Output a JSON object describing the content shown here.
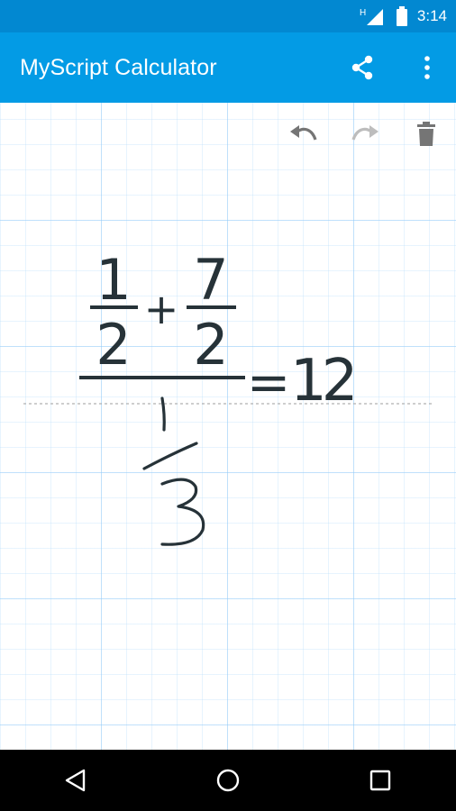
{
  "status_bar": {
    "network_label": "H",
    "time": "3:14"
  },
  "app_bar": {
    "title": "MyScript Calculator",
    "actions": [
      {
        "name": "share",
        "icon": "share-icon"
      },
      {
        "name": "more",
        "icon": "more-vert-icon"
      }
    ]
  },
  "toolbar": {
    "undo_icon": "undo-icon",
    "redo_icon": "redo-icon",
    "delete_icon": "trash-icon"
  },
  "expression": {
    "numerator_left": {
      "top": "1",
      "bottom": "2"
    },
    "operator": "+",
    "numerator_right": {
      "top": "7",
      "bottom": "2"
    },
    "denominator_handwritten": {
      "top": "1",
      "bottom": "3"
    },
    "equals": "=",
    "result": "12"
  },
  "navigation": {
    "back_icon": "back-triangle-icon",
    "home_icon": "home-circle-icon",
    "recents_icon": "recents-square-icon"
  },
  "colors": {
    "status_bar": "#0288d1",
    "app_bar": "#039be5",
    "ink": "#263238",
    "toolbar_icon": "#757575",
    "toolbar_icon_disabled": "#bdbdbd"
  }
}
